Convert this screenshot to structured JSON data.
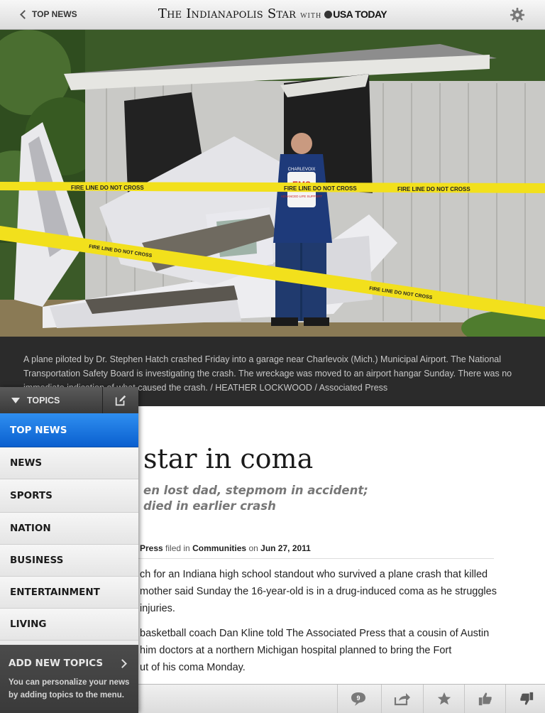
{
  "topbar": {
    "back_label": "TOP NEWS",
    "masthead": "The Indianapolis Star",
    "with": "WITH",
    "partner": "USA TODAY"
  },
  "photo": {
    "tape_text": "FIRE LINE DO NOT CROSS",
    "badge_top": "CHARLEVOIX",
    "badge_mid": "EMS",
    "badge_bottom": "ADVANCED LIFE SUPPORT"
  },
  "caption": "A plane piloted by Dr. Stephen Hatch crashed Friday into a garage near Charlevoix (Mich.) Municipal Airport. The National Transportation Safety Board is investigating the crash. The wreckage was moved to an airport hangar Sunday. There was no immediate indication of what caused the crash. / HEATHER LOCKWOOD / Associated Press",
  "article": {
    "headline": "star in coma",
    "subhead_1": "en lost dad, stepmom in accident;",
    "subhead_2": "died in earlier crash",
    "byline_source": "Press",
    "byline_filed": "filed in",
    "byline_section": "Communities",
    "byline_on": "on",
    "byline_date": "Jun 27, 2011",
    "lines": [
      "ch for an Indiana high school standout who survived a plane crash that killed",
      "mother said Sunday the 16-year-old is in a drug-induced coma as he struggles",
      "injuries.",
      "basketball coach Dan Kline told The Associated Press that a cousin of Austin",
      "him doctors at a northern Michigan hospital planned to bring the Fort",
      "ut of his coma Monday."
    ]
  },
  "menu": {
    "header": "TOPICS",
    "items": [
      "TOP NEWS",
      "NEWS",
      "SPORTS",
      "NATION",
      "BUSINESS",
      "ENTERTAINMENT",
      "LIVING"
    ],
    "active_index": 0,
    "add_new": "ADD NEW TOPICS",
    "add_new_desc": "You can personalize your news by adding topics to the menu."
  },
  "toolbar": {
    "comment_count": "9"
  },
  "colors": {
    "menu_active": "#1a76e0",
    "caption_bg": "#2b2b2b",
    "tape_yellow": "#f2e01c"
  }
}
